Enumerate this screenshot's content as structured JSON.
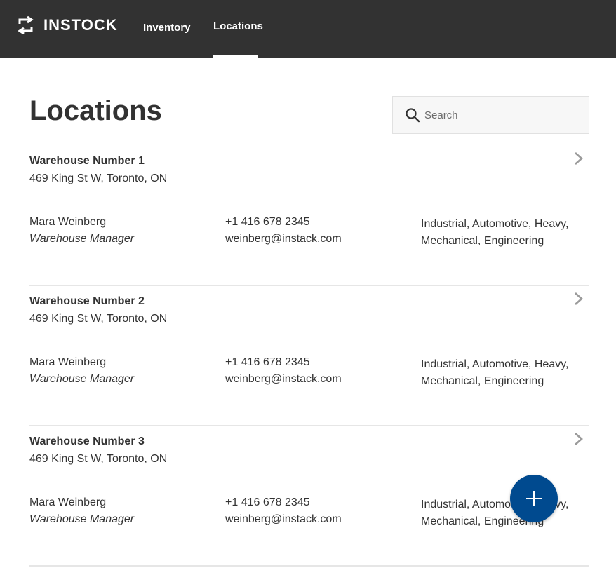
{
  "colors": {
    "header_bg": "#323232",
    "accent": "#004a8f",
    "text": "#323232",
    "divider": "#e6e6e6"
  },
  "brand": {
    "name": "INSTOCK",
    "icon": "swap-arrows-icon"
  },
  "nav": [
    {
      "label": "Inventory",
      "active": false
    },
    {
      "label": "Locations",
      "active": true
    }
  ],
  "page": {
    "title": "Locations"
  },
  "search": {
    "placeholder": "Search",
    "value": "",
    "icon": "search-icon"
  },
  "locations": [
    {
      "name": "Warehouse Number 1",
      "address": "469 King St W, Toronto, ON",
      "contact_name": "Mara Weinberg",
      "contact_title": "Warehouse Manager",
      "phone": "+1 416 678 2345",
      "email": "weinberg@instack.com",
      "categories": "Industrial, Automotive, Heavy, Mechanical, Engineering"
    },
    {
      "name": "Warehouse Number 2",
      "address": "469 King St W, Toronto, ON",
      "contact_name": "Mara Weinberg",
      "contact_title": "Warehouse Manager",
      "phone": "+1 416 678 2345",
      "email": "weinberg@instack.com",
      "categories": "Industrial, Automotive, Heavy, Mechanical, Engineering"
    },
    {
      "name": "Warehouse Number 3",
      "address": "469 King St W, Toronto, ON",
      "contact_name": "Mara Weinberg",
      "contact_title": "Warehouse Manager",
      "phone": "+1 416 678 2345",
      "email": "weinberg@instack.com",
      "categories": "Industrial, Automotive, Heavy, Mechanical, Engineering"
    }
  ],
  "fab": {
    "icon": "plus-icon"
  }
}
